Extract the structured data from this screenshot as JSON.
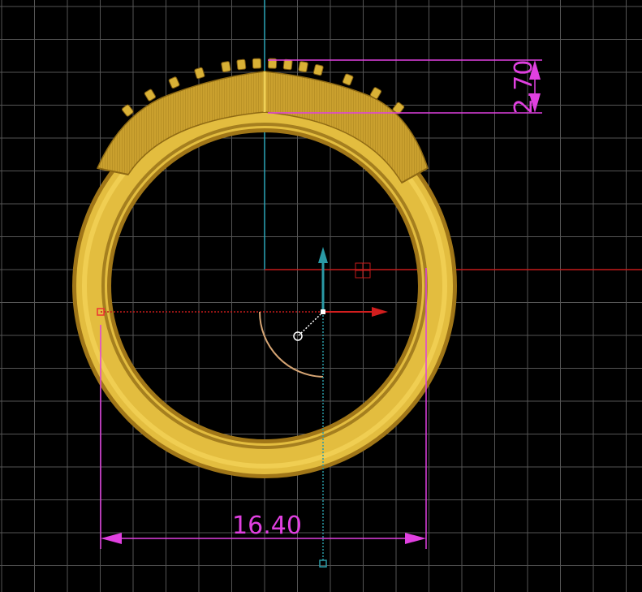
{
  "viewport": {
    "background_color": "#000000",
    "grid_color": "#5a5a5a"
  },
  "model": {
    "ring_color": "#e0b93c",
    "ring_shadow_color": "#a8801c",
    "stone_setting_color": "#d9b136"
  },
  "axes": {
    "vertical_axis_color": "#2aa6b8",
    "horizontal_axis_color": "#c41a1a"
  },
  "gizmo": {
    "y_arrow_color": "#2a9aa6",
    "x_arrow_color": "#d21e1e",
    "arc_color": "#d6a574",
    "handle_icon": "rotate-handle-icon"
  },
  "dimensions": {
    "color": "#e040e0",
    "width": {
      "value": "16.40"
    },
    "height": {
      "value": "2.70"
    }
  }
}
